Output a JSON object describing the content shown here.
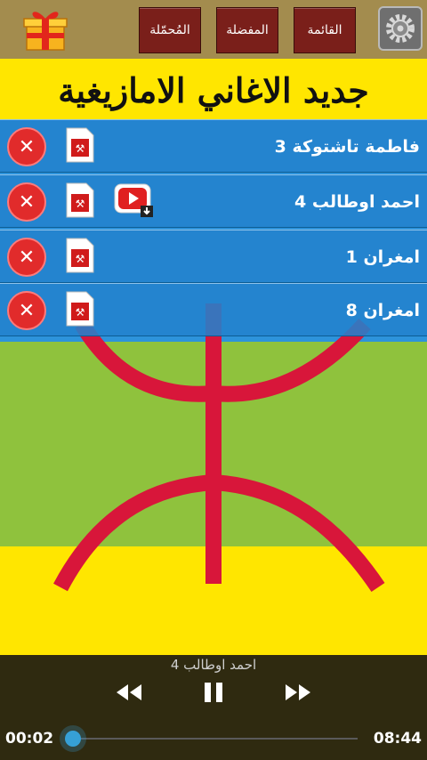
{
  "tabs": [
    {
      "label": "القائمة",
      "active": false
    },
    {
      "label": "المفضلة",
      "active": false
    },
    {
      "label": "المُحمّلة",
      "active": true
    }
  ],
  "icons": {
    "gift": "gift-icon",
    "settings": "settings-icon",
    "delete": "close-icon",
    "file": "file-icon",
    "youtube": "youtube-download-icon"
  },
  "banner_title": "جديد الاغاني الامازيغية",
  "songs": [
    {
      "title": "فاطمة تاشتوكة 3",
      "has_video": false
    },
    {
      "title": "احمد اوطالب 4",
      "has_video": true
    },
    {
      "title": "امغران 1",
      "has_video": false
    },
    {
      "title": "امغران 8",
      "has_video": false
    }
  ],
  "player": {
    "now_playing": "احمد اوطالب 4",
    "elapsed": "00:02",
    "duration": "08:44",
    "progress_fraction": 0.004
  },
  "colors": {
    "flag_blue": "#2d93db",
    "flag_green": "#8fc23d",
    "flag_yellow": "#ffe600",
    "flag_red": "#d8163a"
  }
}
